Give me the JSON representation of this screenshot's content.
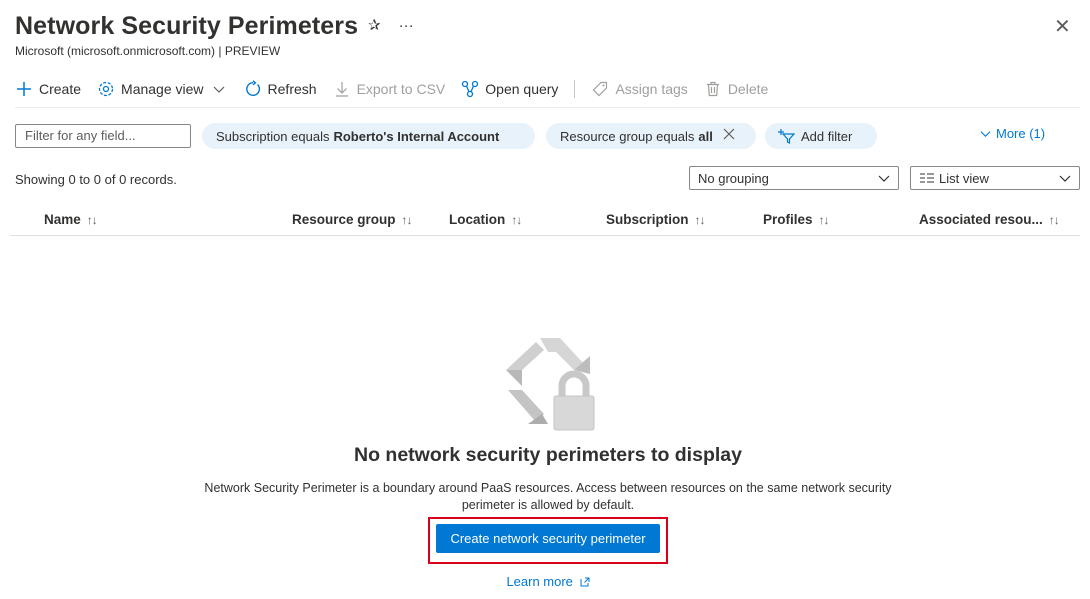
{
  "header": {
    "title": "Network Security Perimeters",
    "subtitle": "Microsoft (microsoft.onmicrosoft.com) | PREVIEW",
    "pin_glyph": "✰",
    "more_glyph": "···",
    "close_glyph": "✕"
  },
  "toolbar": {
    "create": "Create",
    "manage_view": "Manage view",
    "refresh": "Refresh",
    "export_csv": "Export to CSV",
    "open_query": "Open query",
    "assign_tags": "Assign tags",
    "delete": "Delete"
  },
  "filters": {
    "search_placeholder": "Filter for any field...",
    "subscription_prefix": "Subscription equals",
    "subscription_value": "Roberto's Internal Account",
    "resource_group_prefix": "Resource group equals",
    "resource_group_value": "all",
    "add_filter": "Add filter",
    "more": "More (1)"
  },
  "list": {
    "showing": "Showing 0 to 0 of 0 records.",
    "grouping": "No grouping",
    "view": "List view",
    "columns": {
      "name": "Name",
      "resource_group": "Resource group",
      "location": "Location",
      "subscription": "Subscription",
      "profiles": "Profiles",
      "associated": "Associated resou..."
    }
  },
  "empty_state": {
    "title": "No network security perimeters to display",
    "description": "Network Security Perimeter is a boundary around PaaS resources. Access between resources on the same network security perimeter is allowed by default.",
    "cta": "Create network security perimeter",
    "learn_more": "Learn more"
  },
  "colors": {
    "accent": "#0078d4",
    "highlight_outline": "#d9001b",
    "pill_bg": "#e8f2fb"
  }
}
